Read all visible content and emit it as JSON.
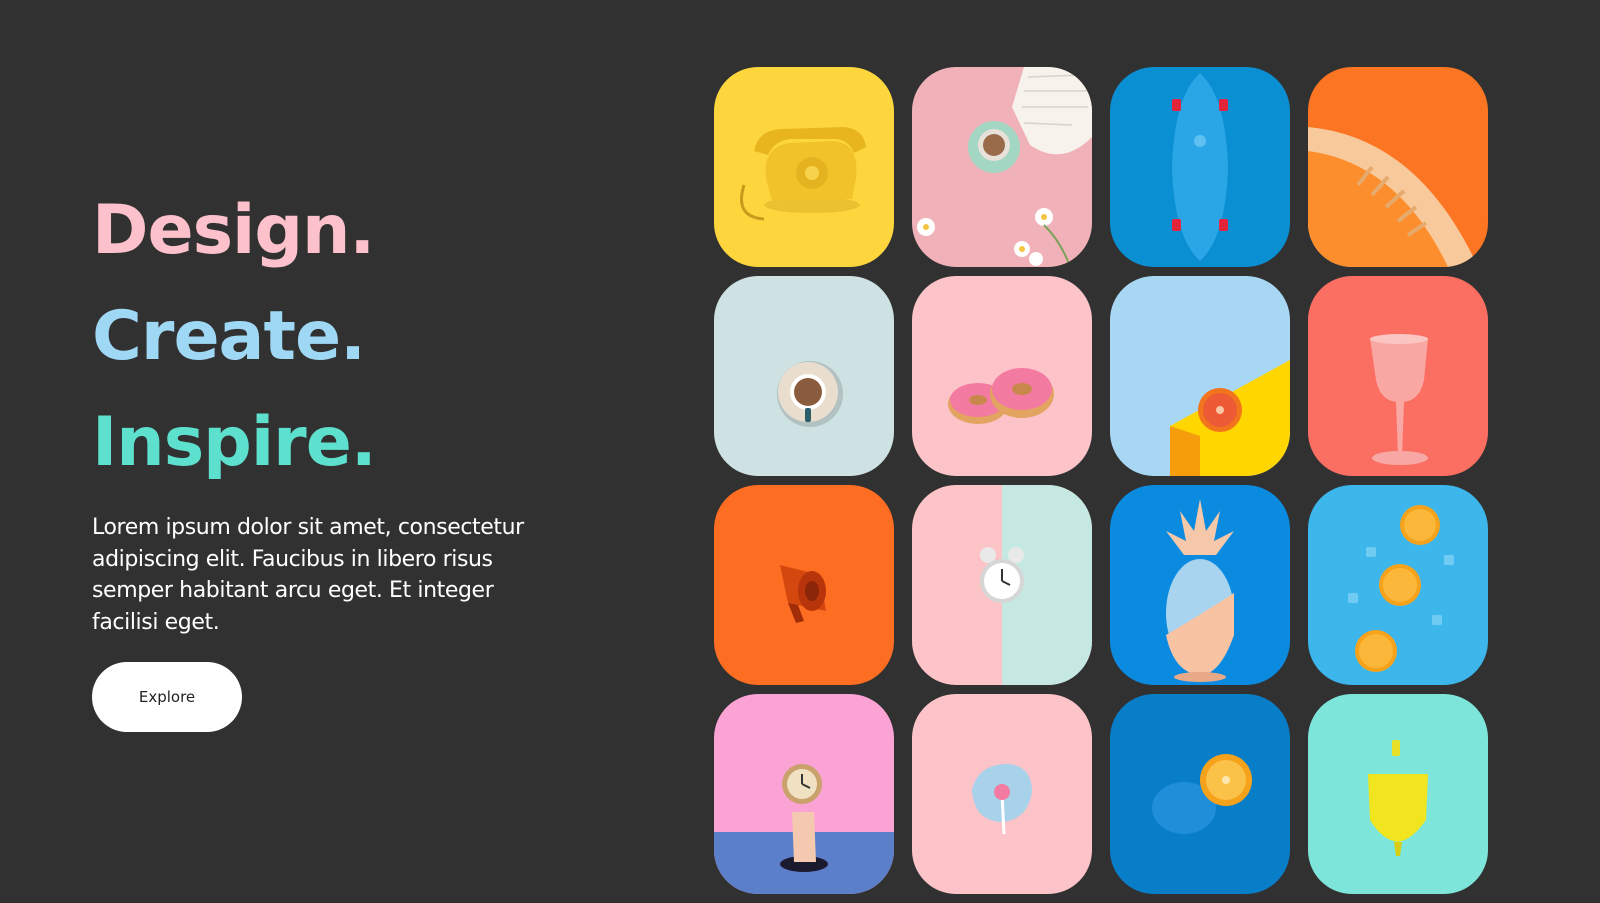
{
  "hero": {
    "line1": "Design.",
    "line2": "Create.",
    "line3": "Inspire.",
    "description": "Lorem ipsum dolor sit amet, consectetur adipiscing elit. Faucibus in libero risus semper habitant arcu eget. Et integer facilisi eget.",
    "cta_label": "Explore"
  },
  "colors": {
    "background": "#313131",
    "design": "#fcc1cb",
    "create": "#9fd8f4",
    "inspire": "#5de0cd"
  },
  "gallery": [
    {
      "subject": "telephone-icon",
      "bg": "#fdd63e"
    },
    {
      "subject": "coffee-cup-icon",
      "bg": "#f0b2b8"
    },
    {
      "subject": "skateboard-icon",
      "bg": "#0a8fd2"
    },
    {
      "subject": "round-object-icon",
      "bg": "#fc7522"
    },
    {
      "subject": "coffee-cup-icon",
      "bg": "#cfe2e3"
    },
    {
      "subject": "donuts-icon",
      "bg": "#fcc3c9"
    },
    {
      "subject": "grapefruit-icon",
      "bg": "#a8d7f3"
    },
    {
      "subject": "wine-glass-icon",
      "bg": "#fb6e62"
    },
    {
      "subject": "megaphone-icon",
      "bg": "#fd6e22"
    },
    {
      "subject": "alarm-clock-icon",
      "bg": "#fcc4c6"
    },
    {
      "subject": "pineapple-icon",
      "bg": "#0b8be0"
    },
    {
      "subject": "oranges-icon",
      "bg": "#3db6ec"
    },
    {
      "subject": "hand-clock-icon",
      "bg": "#fba3d5"
    },
    {
      "subject": "lollipop-icon",
      "bg": "#fcc4c8"
    },
    {
      "subject": "orange-icon",
      "bg": "#087dc8"
    },
    {
      "subject": "teapot-icon",
      "bg": "#7ee5db"
    }
  ]
}
